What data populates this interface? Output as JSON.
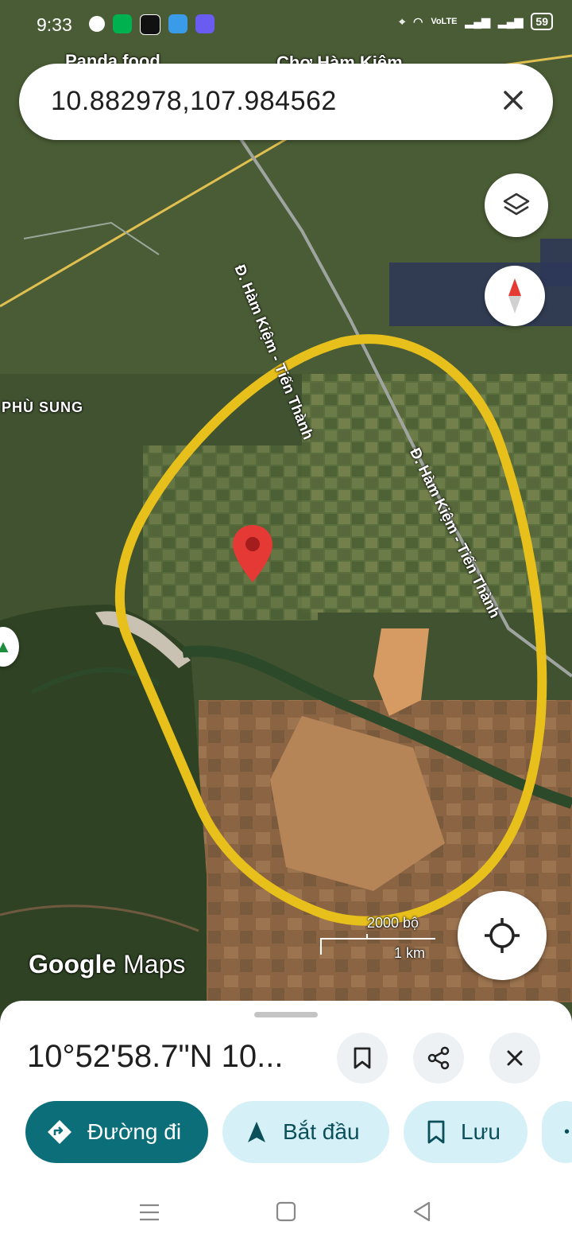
{
  "status_bar": {
    "time": "9:33",
    "network": "VoLTE",
    "battery": "59",
    "app_icons": [
      "facebook-icon",
      "grab-icon",
      "tiktok-icon",
      "messenger-icon",
      "cloud-icon"
    ]
  },
  "map": {
    "peek_labels": [
      "Panda food",
      "Chợ Hàm Kiệm"
    ],
    "place_label": "PHÙ SUNG",
    "road_label_1": "Đ. Hàm Kiệm - Tiến Thành",
    "road_label_2": "Đ. Hàm Kiệm - Tiến Thành",
    "scale_top": "2000 bộ",
    "scale_bottom": "1 km",
    "watermark_brand": "Google",
    "watermark_product": "Maps"
  },
  "search": {
    "query": "10.882978,107.984562"
  },
  "sheet": {
    "title": "10°52'58.7\"N 10...",
    "chips": [
      {
        "label": "Đường đi"
      },
      {
        "label": "Bắt đầu"
      },
      {
        "label": "Lưu"
      }
    ]
  },
  "colors": {
    "primary": "#0b6e79",
    "chip_light": "#d6f0f7",
    "highlight": "#e8c01c",
    "pin": "#e53935"
  }
}
